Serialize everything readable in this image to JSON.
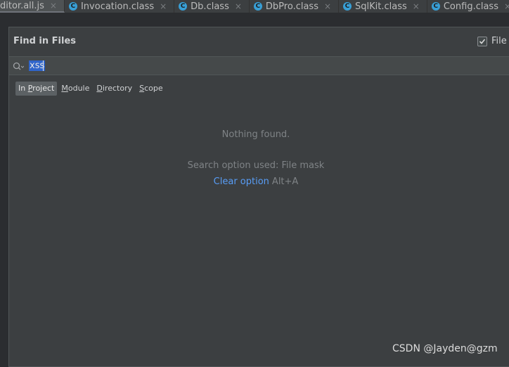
{
  "tabs": [
    {
      "label": "ditor.all.js",
      "icon": "",
      "active": true
    },
    {
      "label": "Invocation.class",
      "icon": "class-icon",
      "active": false
    },
    {
      "label": "Db.class",
      "icon": "class-icon",
      "active": false
    },
    {
      "label": "DbPro.class",
      "icon": "class-icon",
      "active": false
    },
    {
      "label": "SqlKit.class",
      "icon": "class-icon",
      "active": false
    },
    {
      "label": "Config.class",
      "icon": "class-icon",
      "active": false
    }
  ],
  "tab_close_glyph": "×",
  "class_icon_letter": "C",
  "dialog": {
    "title": "Find in Files",
    "file_mask_label": "File m",
    "file_mask_checked": true
  },
  "search": {
    "query": "xss"
  },
  "scopes": {
    "in_project_pre": "In ",
    "in_project_mn": "P",
    "in_project_post": "roject",
    "module_mn": "M",
    "module_post": "odule",
    "directory_mn": "D",
    "directory_post": "irectory",
    "scope_mn": "S",
    "scope_post": "cope"
  },
  "results": {
    "empty_message": "Nothing found.",
    "option_used": "Search option used: File mask",
    "clear_option": "Clear option",
    "clear_shortcut": "Alt+A"
  },
  "watermark": "CSDN @Jayden@gzm",
  "colors": {
    "accent_link": "#589df6",
    "selection": "#2f65ca",
    "class_icon": "#389fd6"
  }
}
